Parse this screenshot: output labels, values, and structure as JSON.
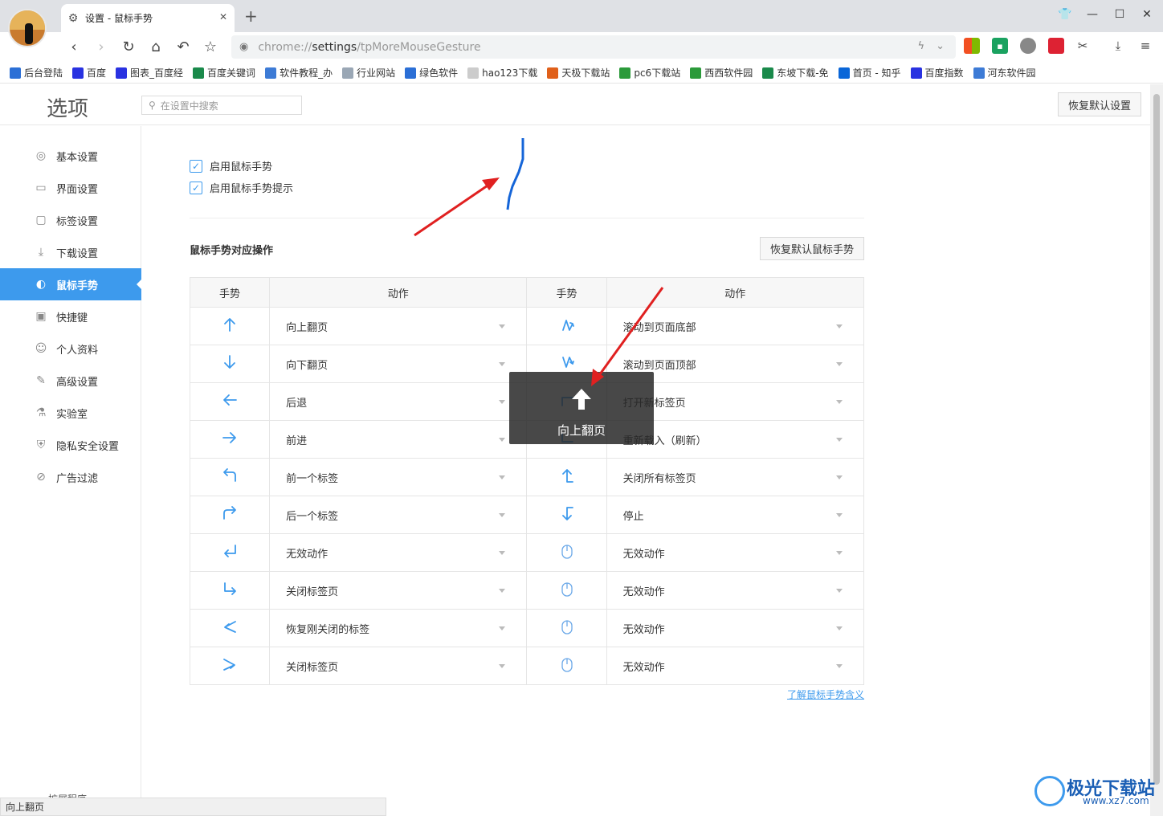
{
  "browser": {
    "tab_title": "设置 - 鼠标手势",
    "tab_close": "✕",
    "new_tab": "+",
    "url_prefix": "chrome://",
    "url_host": "settings",
    "url_path": "/tpMoreMouseGesture",
    "bookmarks": [
      {
        "label": "后台登陆",
        "color": "#2b6fd6"
      },
      {
        "label": "百度",
        "color": "#2932e1"
      },
      {
        "label": "图表_百度经",
        "color": "#2932e1"
      },
      {
        "label": "百度关键词",
        "color": "#1a8a4b"
      },
      {
        "label": "软件教程_办",
        "color": "#3d7bd6"
      },
      {
        "label": "行业网站",
        "color": "#9aa7b5"
      },
      {
        "label": "绿色软件",
        "color": "#2b6fd6"
      },
      {
        "label": "hao123下载",
        "color": "#cccccc"
      },
      {
        "label": "天极下载站",
        "color": "#e0601a"
      },
      {
        "label": "pc6下载站",
        "color": "#2b9a3a"
      },
      {
        "label": "西西软件园",
        "color": "#2b9a3a"
      },
      {
        "label": "东坡下载-免",
        "color": "#1a8a4b"
      },
      {
        "label": "首页 - 知乎",
        "color": "#0a66d8"
      },
      {
        "label": "百度指数",
        "color": "#2932e1"
      },
      {
        "label": "河东软件园",
        "color": "#3d7bd6"
      }
    ]
  },
  "settings": {
    "title": "选项",
    "search_placeholder": "在设置中搜索",
    "restore_defaults": "恢复默认设置",
    "sidebar": [
      {
        "label": "基本设置",
        "icon": "settings-icon"
      },
      {
        "label": "界面设置",
        "icon": "window-icon"
      },
      {
        "label": "标签设置",
        "icon": "tab-icon"
      },
      {
        "label": "下载设置",
        "icon": "download-icon"
      },
      {
        "label": "鼠标手势",
        "icon": "mouse-icon"
      },
      {
        "label": "快捷键",
        "icon": "keyboard-icon"
      },
      {
        "label": "个人资料",
        "icon": "user-icon"
      },
      {
        "label": "高级设置",
        "icon": "wrench-icon"
      },
      {
        "label": "实验室",
        "icon": "flask-icon"
      },
      {
        "label": "隐私安全设置",
        "icon": "shield-icon"
      },
      {
        "label": "广告过滤",
        "icon": "block-icon"
      }
    ],
    "sidebar_bottom": "扩展程序",
    "enable_gesture": "启用鼠标手势",
    "enable_gesture_hint": "启用鼠标手势提示",
    "section_title": "鼠标手势对应操作",
    "restore_gestures": "恢复默认鼠标手势",
    "col_gesture": "手势",
    "col_action": "动作",
    "left_actions": [
      "向上翻页",
      "向下翻页",
      "后退",
      "前进",
      "前一个标签",
      "后一个标签",
      "无效动作",
      "关闭标签页",
      "恢复刚关闭的标签",
      "关闭标签页"
    ],
    "right_actions": [
      "滚动到页面底部",
      "滚动到页面顶部",
      "打开新标签页",
      "重新载入（刷新）",
      "关闭所有标签页",
      "停止",
      "无效动作",
      "无效动作",
      "无效动作",
      "无效动作"
    ],
    "learn_link": "了解鼠标手势含义"
  },
  "toast": {
    "label": "向上翻页",
    "icon": "arrow-up-icon"
  },
  "status_text": "向上翻页",
  "watermark": {
    "title": "极光下载站",
    "url": "www.xz7.com"
  },
  "accent": "#3d9aed"
}
